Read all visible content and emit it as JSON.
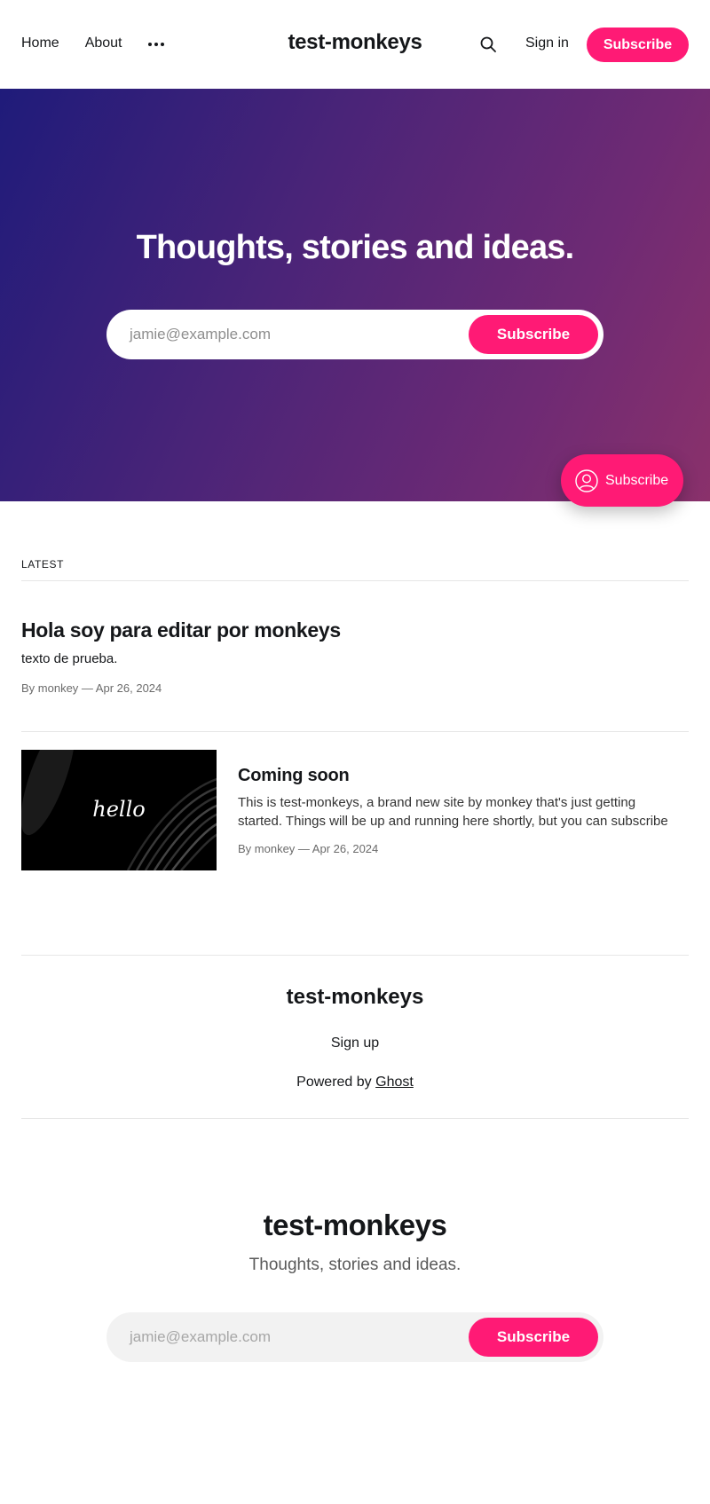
{
  "header": {
    "nav": [
      "Home",
      "About"
    ],
    "site_title": "test-monkeys",
    "signin_label": "Sign in",
    "subscribe_label": "Subscribe"
  },
  "hero": {
    "title": "Thoughts, stories and ideas.",
    "email_placeholder": "jamie@example.com",
    "subscribe_label": "Subscribe"
  },
  "portal": {
    "label": "Subscribe"
  },
  "latest": {
    "label": "LATEST",
    "posts": [
      {
        "title": "Hola soy para editar por monkeys",
        "excerpt": "texto de prueba.",
        "meta": "By monkey — Apr 26, 2024"
      },
      {
        "title": "Coming soon",
        "excerpt_line1": "This is test-monkeys, a brand new site by monkey that's just getting",
        "excerpt_line2": "started. Things will be up and running here shortly, but you can subscribe",
        "meta": "By monkey — Apr 26, 2024",
        "image_text": "hello"
      }
    ]
  },
  "footer": {
    "site_title": "test-monkeys",
    "signup_label": "Sign up",
    "powered_prefix": "Powered by",
    "powered_link": "Ghost"
  },
  "cta": {
    "site_title": "test-monkeys",
    "description": "Thoughts, stories and ideas.",
    "email_placeholder": "jamie@example.com",
    "subscribe_label": "Subscribe"
  },
  "colors": {
    "accent": "#ff1a75",
    "hero_start": "#1f1b7a",
    "hero_end": "#8a316b"
  }
}
